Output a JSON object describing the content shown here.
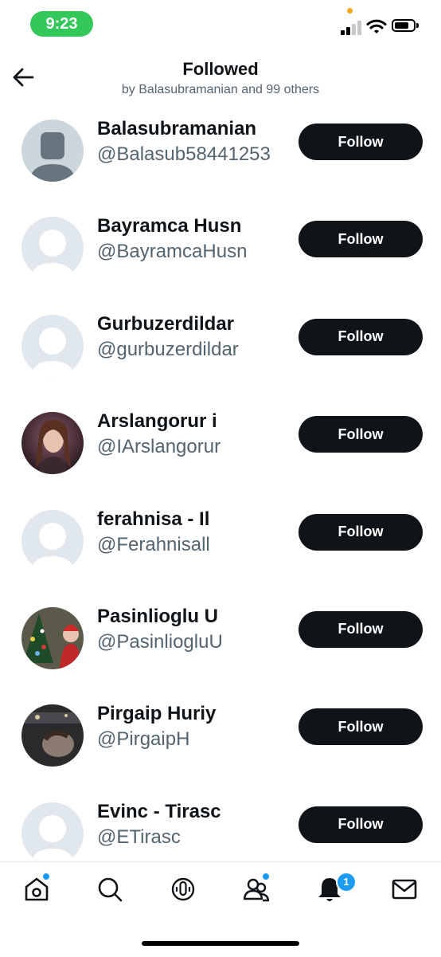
{
  "status_bar": {
    "time": "9:23",
    "time_pill_color": "#34c759"
  },
  "header": {
    "title": "Followed",
    "subtitle": "by Balasubramanian and 99 others"
  },
  "users": [
    {
      "name": "Balasubramanian",
      "handle": "@Balasub58441253",
      "avatar": "default-dark"
    },
    {
      "name": "Bayramca Husn",
      "handle": "@BayramcaHusn",
      "avatar": "default-light"
    },
    {
      "name": "Gurbuzerdildar",
      "handle": "@gurbuzerdildar",
      "avatar": "default-light"
    },
    {
      "name": "Arslangorur i",
      "handle": "@IArslangorur",
      "avatar": "photo-portrait"
    },
    {
      "name": "ferahnisa - Il",
      "handle": "@Ferahnisall",
      "avatar": "default-light"
    },
    {
      "name": "Pasinlioglu U",
      "handle": "@PasinliogluU",
      "avatar": "photo-christmas"
    },
    {
      "name": "Pirgaip Huriy",
      "handle": "@PirgaipH",
      "avatar": "photo-dark"
    },
    {
      "name": "Evinc - Tirasc",
      "handle": "@ETirasc",
      "avatar": "default-light"
    }
  ],
  "follow_label": "Follow",
  "tab_bar": {
    "tabs": [
      "home-icon",
      "search-icon",
      "spaces-icon",
      "communities-icon",
      "notifications-icon",
      "messages-icon"
    ],
    "notification_count": "1"
  },
  "colors": {
    "accent": "#1d9bf0",
    "button": "#0f1419",
    "secondary_text": "#536471"
  }
}
